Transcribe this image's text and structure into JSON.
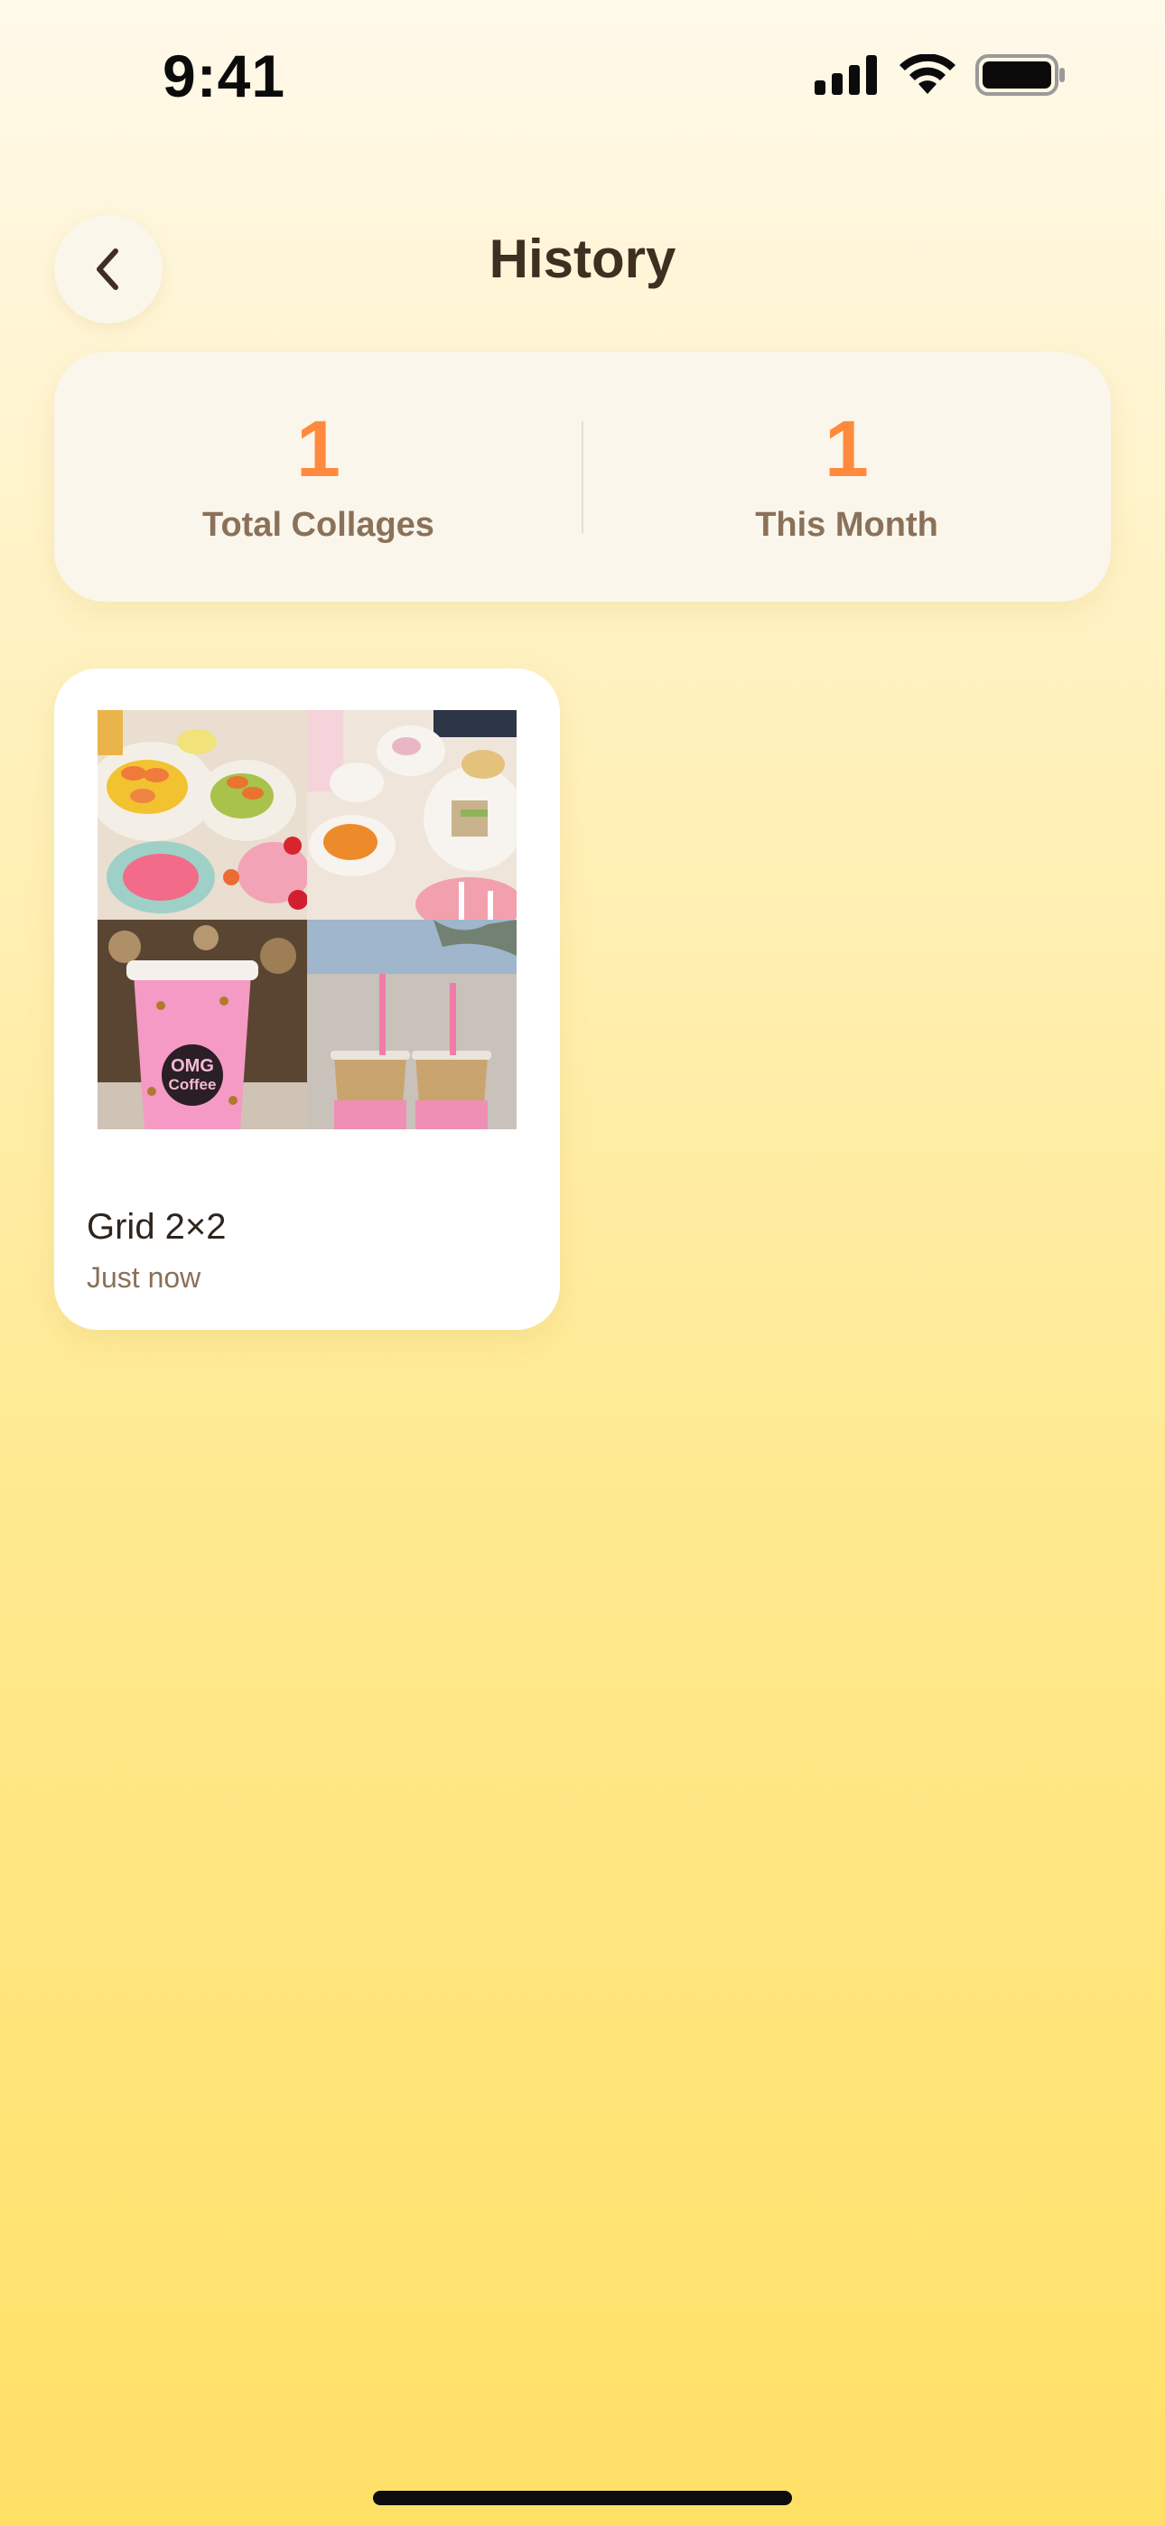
{
  "status_bar": {
    "time": "9:41"
  },
  "header": {
    "title": "History",
    "back_icon": "chevron-left-icon"
  },
  "stats": {
    "total_collages": {
      "value": "1",
      "label": "Total Collages"
    },
    "this_month": {
      "value": "1",
      "label": "This Month"
    }
  },
  "history": [
    {
      "title": "Grid 2×2",
      "time": "Just now",
      "thumbnail": {
        "layout": "grid-2x2",
        "tiles": [
          {
            "subject": "brunch plates with shrimp and avocado toast"
          },
          {
            "subject": "afternoon tea set with pastries and sandwiches"
          },
          {
            "subject": "pink coffee cup with logo",
            "text": "OMG Coffee"
          },
          {
            "subject": "two pink iced drinks with straws"
          }
        ]
      }
    }
  ],
  "colors": {
    "accent": "#ff8a3d",
    "title_text": "#3f2f21",
    "muted_text": "#8a7159",
    "card_background": "#ffffff"
  }
}
